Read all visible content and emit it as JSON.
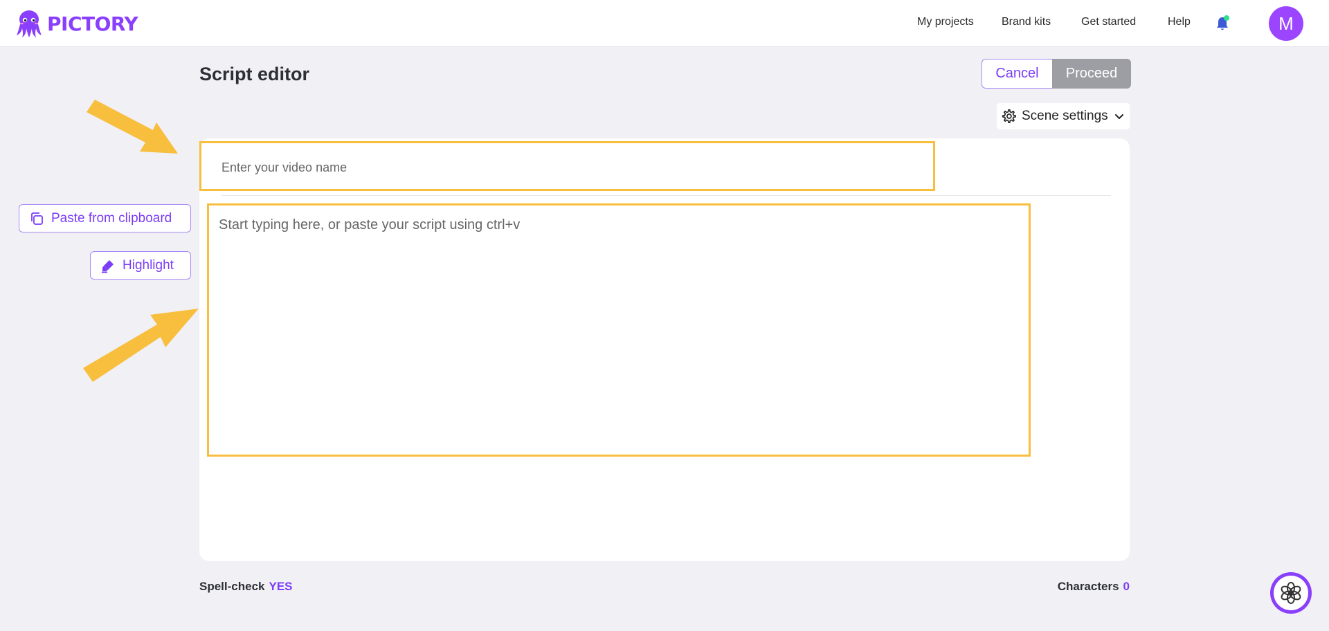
{
  "brand": {
    "name": "PICTORY"
  },
  "nav": {
    "items": [
      "My projects",
      "Brand kits",
      "Get started",
      "Help"
    ],
    "avatar_initial": "M"
  },
  "editor": {
    "title": "Script editor",
    "cancel_label": "Cancel",
    "proceed_label": "Proceed",
    "scene_settings_label": "Scene settings",
    "video_name_placeholder": "Enter your video name",
    "script_placeholder": "Start typing here, or paste your script using ctrl+v"
  },
  "tools": {
    "paste_label": "Paste from clipboard",
    "highlight_label": "Highlight"
  },
  "footer": {
    "spellcheck_label": "Spell-check",
    "spellcheck_value": "YES",
    "characters_label": "Characters",
    "characters_value": "0"
  },
  "colors": {
    "brand": "#8a3ffc",
    "accent_text": "#7b3df6",
    "annotation": "#f8be3e",
    "proceed_disabled": "#9d9da4",
    "notification_dot": "#2ee08a"
  }
}
